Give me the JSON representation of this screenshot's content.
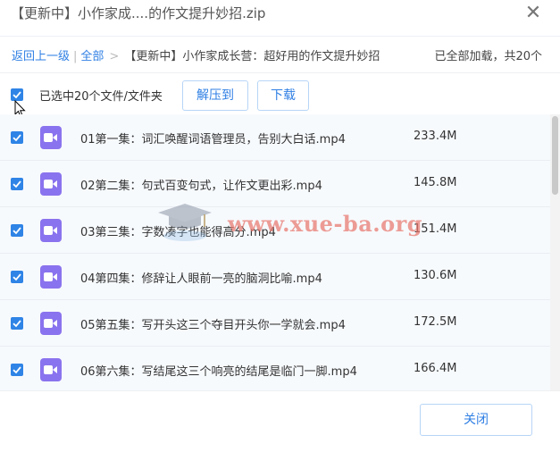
{
  "window": {
    "title": "【更新中】小作家成....的作文提升妙招.zip",
    "close_symbol": "✕"
  },
  "breadcrumb": {
    "back": "返回上一级",
    "all": "全部",
    "sep": ">",
    "current": "【更新中】小作家成长营：超好用的作文提升妙招",
    "loaded_status": "已全部加载，共20个"
  },
  "toolbar": {
    "selected_text": "已选中20个文件/文件夹",
    "extract_label": "解压到",
    "download_label": "下载"
  },
  "files": [
    {
      "name": "01第一集：词汇唤醒词语管理员，告别大白话.mp4",
      "size": "233.4M",
      "checked": true
    },
    {
      "name": "02第二集：句式百变句式，让作文更出彩.mp4",
      "size": "145.8M",
      "checked": true
    },
    {
      "name": "03第三集：字数凑字也能得高分.mp4",
      "size": "151.4M",
      "checked": true
    },
    {
      "name": "04第四集：修辞让人眼前一亮的脑洞比喻.mp4",
      "size": "130.6M",
      "checked": true
    },
    {
      "name": "05第五集：写开头这三个夺目开头你一学就会.mp4",
      "size": "172.5M",
      "checked": true
    },
    {
      "name": "06第六集：写结尾这三个响亮的结尾是临门一脚.mp4",
      "size": "166.4M",
      "checked": true
    }
  ],
  "watermark": {
    "text": "www.xue-ba.org"
  },
  "footer": {
    "close_label": "关闭"
  },
  "colors": {
    "accent": "#2f84e6",
    "link": "#2f7fe4",
    "video_icon": "#8a73ee",
    "watermark": "#e7766c"
  }
}
